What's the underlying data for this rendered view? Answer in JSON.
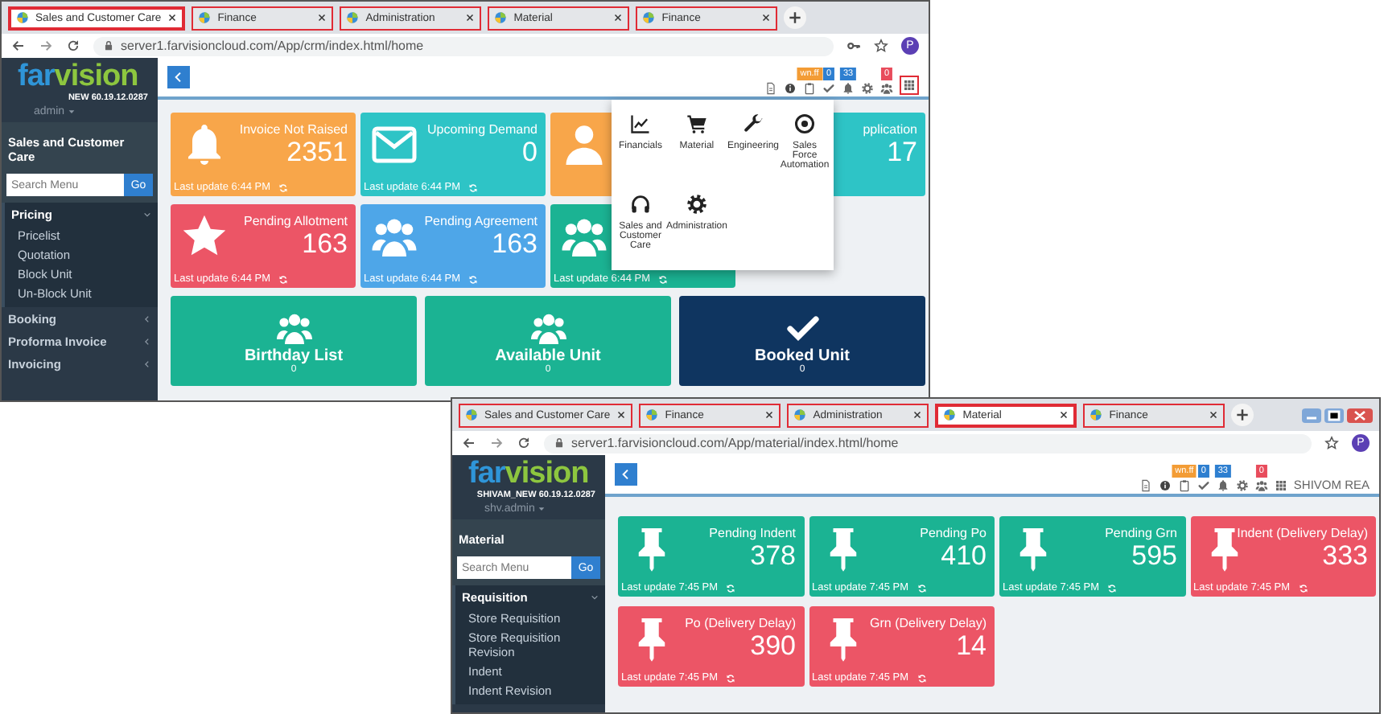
{
  "windows": [
    {
      "tabs": [
        {
          "label": "Sales and Customer Care",
          "selected": true
        },
        {
          "label": "Finance",
          "selected": false
        },
        {
          "label": "Administration",
          "selected": false
        },
        {
          "label": "Material",
          "selected": false
        },
        {
          "label": "Finance",
          "selected": false
        }
      ],
      "strip_controls": [
        {
          "kind": "new_tab"
        }
      ],
      "address": "server1.farvisioncloud.com/App/crm/index.html/home",
      "address_icons": [
        {
          "kind": "key"
        },
        {
          "kind": "star"
        }
      ],
      "profile": "P",
      "app": {
        "logo_left": "far",
        "logo_right": "vision",
        "version": "NEW 60.19.12.0287",
        "user": "admin",
        "section": "Sales and Customer Care",
        "search_placeholder": "Search Menu",
        "search_button": "Go",
        "menu": [
          {
            "label": "Pricing",
            "expanded": true,
            "children": [
              {
                "label": "Pricelist"
              },
              {
                "label": "Quotation"
              },
              {
                "label": "Block Unit"
              },
              {
                "label": "Un-Block Unit"
              }
            ]
          },
          {
            "label": "Booking",
            "expanded": false
          },
          {
            "label": "Proforma Invoice",
            "expanded": false
          },
          {
            "label": "Invoicing",
            "expanded": false
          }
        ],
        "header_icons": [
          {
            "kind": "document"
          },
          {
            "kind": "info"
          },
          {
            "kind": "clipboard",
            "badge": "wn.ff",
            "color": "#f39c35"
          },
          {
            "kind": "check",
            "badge": "0",
            "color": "#2e7fd0"
          },
          {
            "kind": "bell",
            "badge": "33",
            "color": "#2e7fd0"
          },
          {
            "kind": "gear"
          },
          {
            "kind": "people",
            "badge": "0",
            "color": "#e84c5c"
          },
          {
            "kind": "apps",
            "highlighted": true
          }
        ],
        "tiles": [
          {
            "kind": "bell",
            "title": "Invoice Not Raised",
            "value": "2351",
            "footer": "Last update 6:44 PM",
            "color": "#f8a64a"
          },
          {
            "kind": "envelope",
            "title": "Upcoming Demand",
            "value": "0",
            "footer": "Last update 6:44 PM",
            "color": "#2ec4c6"
          },
          {
            "kind": "person",
            "color": "#f8a64a"
          },
          {
            "kind": "plain",
            "title": "pplication",
            "value": "17",
            "color": "#2ec4c6"
          },
          {
            "kind": "star",
            "title": "Pending Allotment",
            "value": "163",
            "footer": "Last update 6:44 PM",
            "color": "#ec5566"
          },
          {
            "kind": "people",
            "title": "Pending Agreement",
            "value": "163",
            "footer": "Last update 6:44 PM",
            "color": "#4ea6e8"
          },
          {
            "kind": "people",
            "footer": "Last update 6:44 PM",
            "color": "#1bb393"
          }
        ],
        "summary_tiles": [
          {
            "kind": "people",
            "title": "Birthday List",
            "value": "0",
            "color": "#1bb393"
          },
          {
            "kind": "people",
            "title": "Available Unit",
            "value": "0",
            "color": "#1bb393"
          },
          {
            "kind": "check",
            "title": "Booked Unit",
            "value": "0",
            "color": "#0f3560"
          }
        ],
        "apps_menu": [
          {
            "kind": "chart",
            "label": "Financials"
          },
          {
            "kind": "cart",
            "label": "Material"
          },
          {
            "kind": "wrench",
            "label": "Engineering"
          },
          {
            "kind": "target",
            "label": "Sales Force Automation"
          },
          {
            "kind": "headphones",
            "label": "Sales and Customer Care"
          },
          {
            "kind": "gear",
            "label": "Administration"
          }
        ]
      }
    },
    {
      "tabs": [
        {
          "label": "Sales and Customer Care",
          "selected": false
        },
        {
          "label": "Finance",
          "selected": false
        },
        {
          "label": "Administration",
          "selected": false
        },
        {
          "label": "Material",
          "selected": true
        },
        {
          "label": "Finance",
          "selected": false
        }
      ],
      "strip_controls": [
        {
          "kind": "new_tab"
        },
        {
          "kind": "window_controls"
        }
      ],
      "address": "server1.farvisioncloud.com/App/material/index.html/home",
      "address_icons": [
        {
          "kind": "star"
        }
      ],
      "profile": "P",
      "app": {
        "logo_left": "far",
        "logo_right": "vision",
        "version": "SHIVAM_NEW 60.19.12.0287",
        "user": "shv.admin",
        "section": "Material",
        "search_placeholder": "Search Menu",
        "search_button": "Go",
        "menu": [
          {
            "label": "Requisition",
            "expanded": true,
            "children": [
              {
                "label": "Store Requisition"
              },
              {
                "label": "Store Requisition Revision"
              },
              {
                "label": "Indent"
              },
              {
                "label": "Indent Revision"
              }
            ]
          }
        ],
        "header_icons": [
          {
            "kind": "document"
          },
          {
            "kind": "info"
          },
          {
            "kind": "clipboard",
            "badge": "wn.ff",
            "color": "#f39c35"
          },
          {
            "kind": "check",
            "badge": "0",
            "color": "#2e7fd0"
          },
          {
            "kind": "bell",
            "badge": "33",
            "color": "#2e7fd0"
          },
          {
            "kind": "gear"
          },
          {
            "kind": "people",
            "badge": "0",
            "color": "#e84c5c"
          },
          {
            "kind": "apps",
            "highlighted": false
          }
        ],
        "user_name": "SHIVOM REA",
        "tiles": [
          {
            "kind": "pin",
            "title": "Pending Indent",
            "value": "378",
            "footer": "Last update 7:45 PM",
            "color": "#1bb393"
          },
          {
            "kind": "pin",
            "title": "Pending Po",
            "value": "410",
            "footer": "Last update 7:45 PM",
            "color": "#1bb393"
          },
          {
            "kind": "pin",
            "title": "Pending Grn",
            "value": "595",
            "footer": "Last update 7:45 PM",
            "color": "#1bb393"
          },
          {
            "kind": "pin",
            "title": "Indent (Delivery Delay)",
            "value": "333",
            "footer": "Last update 7:45 PM",
            "color": "#ec5566"
          },
          {
            "kind": "pin",
            "title": "Po (Delivery Delay)",
            "value": "390",
            "footer": "Last update 7:45 PM",
            "color": "#ec5566"
          },
          {
            "kind": "pin",
            "title": "Grn (Delivery Delay)",
            "value": "14",
            "footer": "Last update 7:45 PM",
            "color": "#ec5566"
          }
        ]
      }
    }
  ]
}
